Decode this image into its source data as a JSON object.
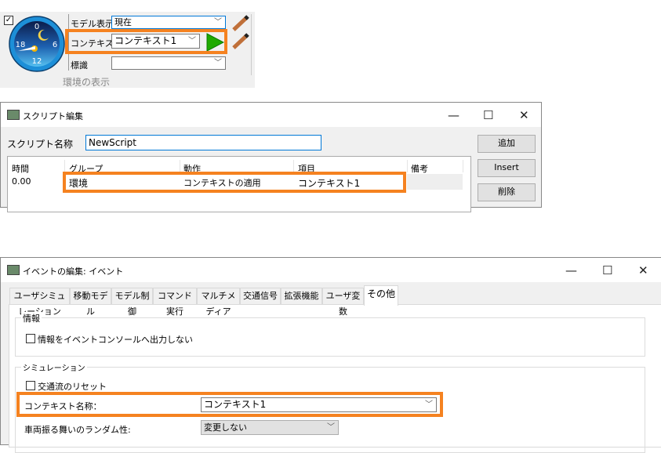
{
  "env_panel": {
    "model_display_label": "モデル表示",
    "model_display_value": "現在",
    "context_label": "コンテキスト",
    "context_value": "コンテキスト1",
    "sign_label": "標識",
    "sign_value": "",
    "group_title": "環境の表示",
    "clock_numbers": [
      "0",
      "6",
      "12",
      "18"
    ]
  },
  "script_window": {
    "title": "スクリプト編集",
    "name_label": "スクリプト名称",
    "name_value": "NewScript",
    "buttons": {
      "add": "追加",
      "insert": "Insert",
      "delete": "削除"
    },
    "columns": [
      "時間",
      "グループ",
      "動作",
      "項目",
      "備考"
    ],
    "rows": [
      [
        "0.00",
        "環境",
        "コンテキストの適用",
        "コンテキスト1",
        ""
      ]
    ]
  },
  "event_window": {
    "title": "イベントの編集: イベント",
    "tabs": [
      "ユーザシミュレーション",
      "移動モデル",
      "モデル制御",
      "コマンド実行",
      "マルチメディア",
      "交通信号",
      "拡張機能",
      "ユーザ変数",
      "その他"
    ],
    "active_tab": "その他",
    "info_group": "情報",
    "info_checkbox": "情報をイベントコンソールへ出力しない",
    "sim_group": "シミュレーション",
    "reset_checkbox": "交通流のリセット",
    "context_name_label": "コンテキスト名称：",
    "context_name_value": "コンテキスト1",
    "random_label": "車両振る舞いのランダム性:",
    "random_value": "変更しない"
  },
  "colors": {
    "highlight": "#f58220",
    "play": "#1faa00"
  }
}
